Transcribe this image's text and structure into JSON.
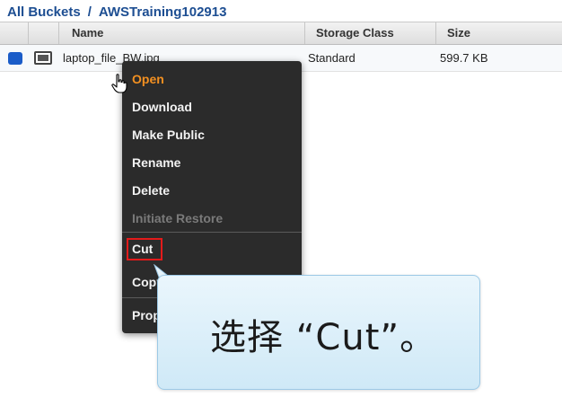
{
  "breadcrumb": {
    "root": "All Buckets",
    "separator": "/",
    "bucket": "AWSTraining102913"
  },
  "table": {
    "headers": {
      "name": "Name",
      "storage_class": "Storage Class",
      "size": "Size"
    },
    "rows": [
      {
        "name": "laptop_file_BW.jpg",
        "storage_class": "Standard",
        "size": "599.7 KB"
      }
    ]
  },
  "context_menu": {
    "items": [
      {
        "label": "Open"
      },
      {
        "label": "Download"
      },
      {
        "label": "Make Public"
      },
      {
        "label": "Rename"
      },
      {
        "label": "Delete"
      },
      {
        "label": "Initiate Restore",
        "disabled": true
      },
      {
        "label": "Cut"
      },
      {
        "label": "Copy"
      },
      {
        "label": "Properties"
      }
    ]
  },
  "callout": {
    "text": "选择 “Cut”。"
  },
  "colors": {
    "accent_open": "#f39021",
    "highlight_border": "#e31b1b",
    "menu_bg": "#2b2b2b",
    "link_blue": "#1d4e92",
    "callout_bg": "#d9eef9"
  },
  "icons": {
    "row_select": "selected-checkbox-icon",
    "row_file": "file-icon",
    "cursor": "hand-pointer-icon"
  }
}
